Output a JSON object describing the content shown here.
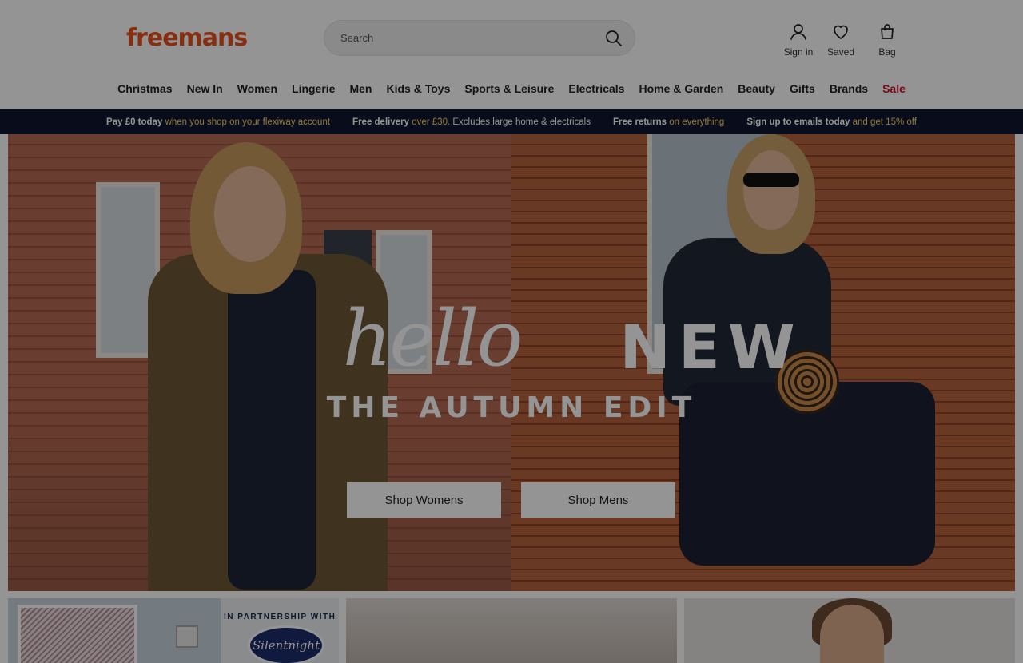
{
  "header": {
    "logo": "freemans",
    "search": {
      "placeholder": "Search"
    },
    "account": {
      "sign_in": "Sign in",
      "saved": "Saved",
      "bag": "Bag"
    }
  },
  "nav": {
    "items": [
      "Christmas",
      "New In",
      "Women",
      "Lingerie",
      "Men",
      "Kids & Toys",
      "Sports & Leisure",
      "Electricals",
      "Home & Garden",
      "Beauty",
      "Gifts",
      "Brands",
      "Sale"
    ]
  },
  "promo": {
    "items": [
      {
        "bold": "Pay £0 today",
        "highlight": "when you shop on your flexiway account",
        "rest": ""
      },
      {
        "bold": "Free delivery",
        "highlight": "over £30.",
        "rest": "Excludes large home & electricals"
      },
      {
        "bold": "Free returns",
        "highlight": "on everything",
        "rest": ""
      },
      {
        "bold": "Sign up to emails today",
        "highlight": "and get 15% off",
        "rest": ""
      }
    ]
  },
  "hero": {
    "title_script": "hello",
    "title_caps": "NEW",
    "subtitle": "THE AUTUMN EDIT",
    "cta_womens": "Shop Womens",
    "cta_mens": "Shop Mens"
  },
  "tiles": {
    "partner_text": "IN PARTNERSHIP WITH",
    "partner_brand": "Silentnight"
  },
  "colors": {
    "brand": "#e8501c",
    "promo_bg": "#11162e",
    "promo_highlight": "#f5d56b",
    "sale": "#d0102a",
    "overlay": "rgba(0,0,0,0.42)"
  }
}
